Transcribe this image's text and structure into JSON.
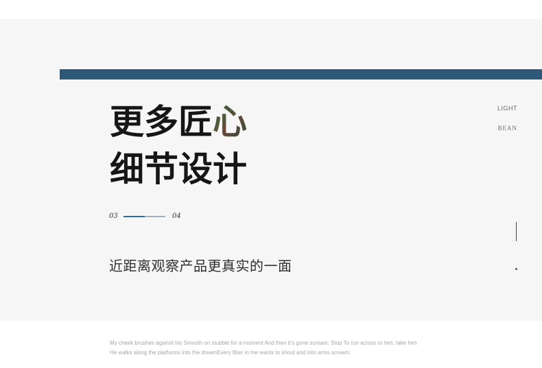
{
  "headline": {
    "line1_plain": "更多匠",
    "line1_tinted": "心",
    "line2": "细节设计"
  },
  "pager": {
    "current": "03",
    "next": "04",
    "progress_fraction": 0.5
  },
  "subtitle": "近距离观察产品更真实的一面",
  "side_labels": {
    "top": "LIGHT",
    "bottom": "BEAN"
  },
  "footnotes": [
    "My cheek brushes against his Smooth on stubble for a moment And then it's gone scream: Stop To run across to him, take him",
    "He walks along the platforms into the dreamEvery fiber in me wants to shout and into  arms scream:"
  ],
  "colors": {
    "accent_bar": "#2d5877",
    "pager_fill": "#2d6aa0",
    "pager_track": "#9fb0bd",
    "panel_bg": "#f6f6f6"
  }
}
